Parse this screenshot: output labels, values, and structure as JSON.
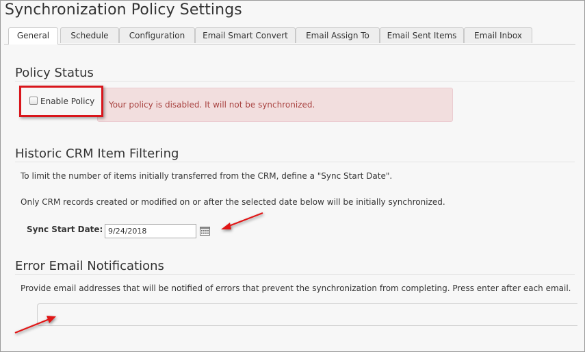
{
  "page_title": "Synchronization Policy Settings",
  "tabs": [
    {
      "label": "General",
      "active": true
    },
    {
      "label": "Schedule",
      "active": false
    },
    {
      "label": "Configuration",
      "active": false
    },
    {
      "label": "Email Smart Convert",
      "active": false
    },
    {
      "label": "Email Assign To",
      "active": false
    },
    {
      "label": "Email Sent Items",
      "active": false
    },
    {
      "label": "Email Inbox",
      "active": false
    }
  ],
  "policy_status": {
    "heading": "Policy Status",
    "enable_label": "Enable Policy",
    "enabled": false,
    "alert_text": "Your policy is disabled. It will not be synchronized."
  },
  "historic": {
    "heading": "Historic CRM Item Filtering",
    "text1": "To limit the number of items initially transferred from the CRM, define a \"Sync Start Date\".",
    "text2": "Only CRM records created or modified on or after the selected date below will be initially synchronized.",
    "date_label": "Sync Start Date:",
    "date_value": "9/24/2018"
  },
  "error_email": {
    "heading": "Error Email Notifications",
    "text": "Provide email addresses that will be notified of errors that prevent the synchronization from completing. Press enter after each email.",
    "value": ""
  },
  "icons": {
    "calendar": "calendar-icon",
    "arrow": "red-arrow-annotation"
  },
  "colors": {
    "alert_bg": "#f2dede",
    "alert_text": "#a94442",
    "highlight": "#d9161c"
  }
}
